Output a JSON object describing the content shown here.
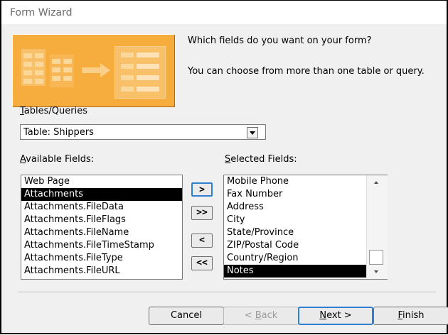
{
  "window": {
    "title": "Form Wizard"
  },
  "prompt": {
    "question": "Which fields do you want on your form?",
    "hint": "You can choose from more than one table or query."
  },
  "tables_queries": {
    "label": "Tables/Queries",
    "accesskey": "T",
    "label_rest": "ables/Queries",
    "selected": "Table: Shippers"
  },
  "available_fields": {
    "label_key": "A",
    "label_rest": "vailable Fields:",
    "items": [
      "Web Page",
      "Attachments",
      "Attachments.FileData",
      "Attachments.FileFlags",
      "Attachments.FileName",
      "Attachments.FileTimeStamp",
      "Attachments.FileType",
      "Attachments.FileURL"
    ],
    "selected_index": 1
  },
  "selected_fields": {
    "label_key": "S",
    "label_rest": "elected Fields:",
    "items": [
      "Mobile Phone",
      "Fax Number",
      "Address",
      "City",
      "State/Province",
      "ZIP/Postal Code",
      "Country/Region",
      "Notes"
    ],
    "selected_index": 7
  },
  "move_buttons": {
    "add_one": ">",
    "add_all": ">>",
    "remove_one": "<",
    "remove_all": "<<"
  },
  "buttons": {
    "cancel": "Cancel",
    "back_prefix": "< ",
    "back_key": "B",
    "back_rest": "ack",
    "next_key": "N",
    "next_rest": "ext >",
    "finish_key": "F",
    "finish_rest": "inish"
  },
  "icons": {
    "combo_dropdown": "chevron-down-icon",
    "scroll_up": "scroll-up-icon",
    "scroll_down": "scroll-down-icon"
  }
}
